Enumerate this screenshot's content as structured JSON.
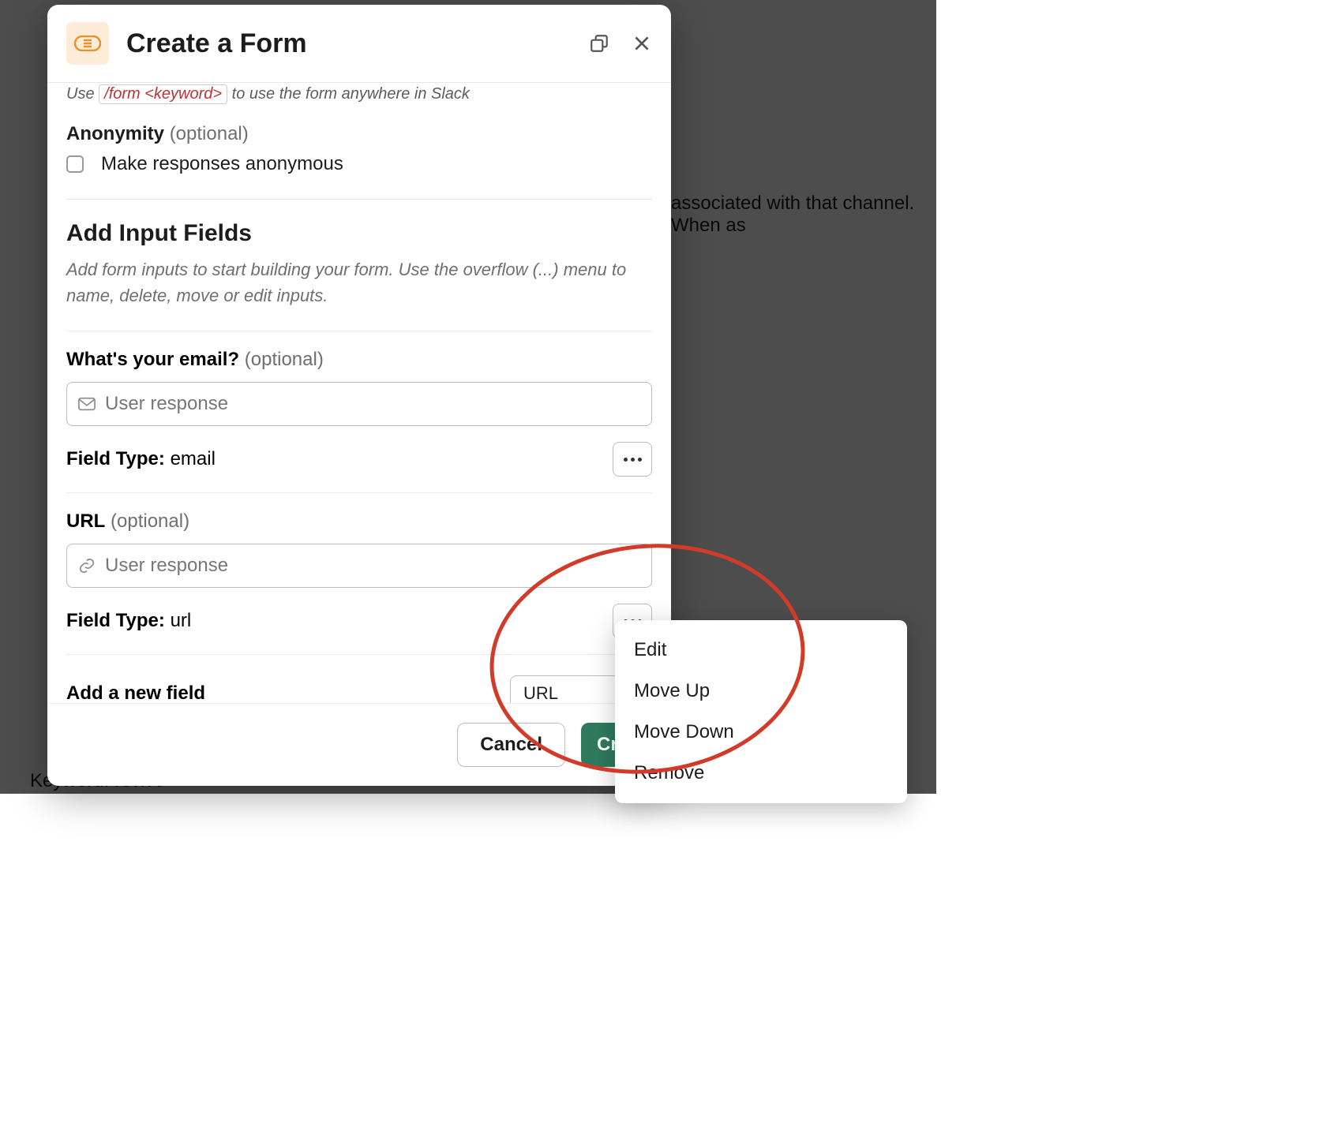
{
  "background": {
    "right_text": "associated with that channel. When as",
    "keyword_line": "Keyword: revive"
  },
  "modal": {
    "title": "Create a Form",
    "cutoff_pre": "Use",
    "cutoff_kbd": "/form <keyword>",
    "cutoff_post": "to use the form anywhere in Slack",
    "anonymity": {
      "label": "Anonymity",
      "optional": "(optional)",
      "checkbox_label": "Make responses anonymous"
    },
    "input_section": {
      "heading": "Add Input Fields",
      "help": "Add form inputs to start building your form. Use the overflow (...) menu to name, delete, move or edit inputs."
    },
    "fields": [
      {
        "label": "What's your email?",
        "optional": "(optional)",
        "placeholder": "User response",
        "type_label": "Field Type:",
        "type_value": "email",
        "icon": "mail"
      },
      {
        "label": "URL",
        "optional": "(optional)",
        "placeholder": "User response",
        "type_label": "Field Type:",
        "type_value": "url",
        "icon": "link"
      }
    ],
    "add_field": {
      "label": "Add a new field",
      "selected": "URL"
    },
    "footer": {
      "cancel": "Cancel",
      "create": "Create"
    }
  },
  "context_menu": {
    "items": [
      "Edit",
      "Move Up",
      "Move Down",
      "Remove"
    ]
  }
}
